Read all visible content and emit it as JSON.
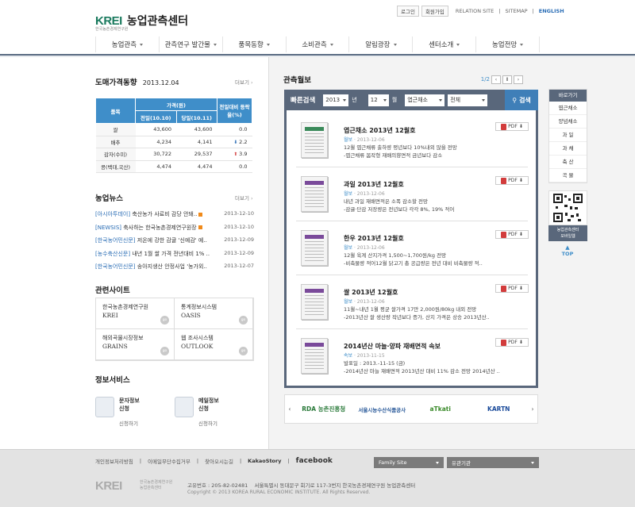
{
  "header": {
    "logo_mark": "KREI",
    "logo_sub": "한국농촌경제연구원",
    "title": "농업관측센터",
    "util": {
      "login": "로그인",
      "join": "회원가입",
      "relation": "RELATION SITE",
      "sitemap": "SITEMAP",
      "english": "ENGLISH"
    }
  },
  "nav": [
    "농업관측",
    "관측연구 발간물",
    "품목동향",
    "소비관측",
    "알림광장",
    "센터소개",
    "농업전망"
  ],
  "price": {
    "title": "도매가격동향",
    "date": "2013.12.04",
    "more": "더보기",
    "h_item": "품목",
    "h_price": "가격(원)",
    "h_change": "전일대비 등락율(%)",
    "h_prev": "전일(10.10)",
    "h_today": "당일(10.11)",
    "rows": [
      {
        "item": "쌀",
        "prev": "43,600",
        "today": "43,600",
        "dir": "",
        "rate": "0.0"
      },
      {
        "item": "배추",
        "prev": "4,234",
        "today": "4,141",
        "dir": "down",
        "rate": "2.2"
      },
      {
        "item": "감자(수미)",
        "prev": "30,722",
        "today": "29,537",
        "dir": "up",
        "rate": "3.9"
      },
      {
        "item": "콩(백태,국산)",
        "prev": "4,474",
        "today": "4,474",
        "dir": "",
        "rate": "0.0"
      }
    ]
  },
  "news": {
    "title": "농업뉴스",
    "more": "더보기",
    "items": [
      {
        "src": "[아시아투데이]",
        "text": "축산농가 사료비 감당 안돼..",
        "date": "2013-12-10",
        "new": true
      },
      {
        "src": "[NEWSIS]",
        "text": "축사하는 한국농촌경제연구원장",
        "date": "2013-12-10",
        "new": true
      },
      {
        "src": "[한국농어민신문]",
        "text": "저온에 강한 감귤 '신예감' 예..",
        "date": "2013-12-09",
        "new": false
      },
      {
        "src": "[농수축산신문]",
        "text": "내년 1월 쌀 가격 전년대비 1% ..",
        "date": "2013-12-09",
        "new": false
      },
      {
        "src": "[한국농어민신문]",
        "text": "송아지생산 안정사업 '농가외..",
        "date": "2013-12-07",
        "new": false
      }
    ]
  },
  "related": {
    "title": "관련사이트",
    "go": "go",
    "sites": [
      {
        "ko": "한국농촌경제연구원",
        "en": "KREI"
      },
      {
        "ko": "통계정보시스템",
        "en": "OASIS"
      },
      {
        "ko": "해외곡물시장정보",
        "en": "GRAINS"
      },
      {
        "ko": "웹 조사시스템",
        "en": "OUTLOOK"
      }
    ]
  },
  "service": {
    "title": "정보서비스",
    "items": [
      {
        "name": "문자정보\n신청",
        "link": "신청하기"
      },
      {
        "name": "메일정보\n신청",
        "link": "신청하기"
      }
    ]
  },
  "report": {
    "title": "관측월보",
    "page": "1/2",
    "search_label": "빠른검색",
    "year": "2013",
    "year_unit": "년",
    "month": "12",
    "month_unit": "월",
    "category": "엽근채소",
    "kind": "전체",
    "search_btn": "검색",
    "pdf": "PDF",
    "items": [
      {
        "title": "엽근채소 2013년 12월호",
        "cat": "월보",
        "date": "2013-12-06",
        "l1": "12월 엽근채류 출하량 평년보다 10%내외 많을 전망",
        "l2": "-엽근채류 봄작형 재배의향면적 금년보다 감소",
        "thumb": "green"
      },
      {
        "title": "과일 2013년 12월호",
        "cat": "월보",
        "date": "2013-12-06",
        "l1": "내년 과일 재배면적은 소폭 감소할 전망",
        "l2": "-감귤·단감 저장량은 전년보다 각각 8%, 19% 적어",
        "thumb": "purple"
      },
      {
        "title": "한우 2013년 12월호",
        "cat": "월보",
        "date": "2013-12-06",
        "l1": "12월 육계 산지가격 1,500~1,700원/kg 전망",
        "l2": "-비축물량 적어12월 닭고기 총 공급량은 전년 대비 비축물량 적..",
        "thumb": "purple"
      },
      {
        "title": "쌀 2013년 12월호",
        "cat": "월보",
        "date": "2013-12-06",
        "l1": "11월~내년 1월 평균 쌀가격 17만 2,000원/80kg 내외 전망",
        "l2": "-2013년산 쌀 생산량 작년보다 증가, 산지 가격은 상승 2013년산..",
        "thumb": "purple"
      },
      {
        "title": "2014년산 마늘·양파 재배면적 속보",
        "cat": "속보",
        "date": "2013-11-15",
        "l1": "발표일 : 2013.-11-15 (금)",
        "l2": "-2014년산 마늘 재배면적 2013년산 대비 11% 감소 전망 2014년산 ..",
        "thumb": "purple"
      }
    ]
  },
  "banner": {
    "logos": [
      "RDA 농촌진흥청",
      "서울시농수산식품공사",
      "aTkati",
      "KARTN"
    ]
  },
  "quick": {
    "title": "바로가기",
    "items": [
      "엽근채소",
      "양념채소",
      "과 일",
      "과 채",
      "축 산",
      "곡 물"
    ],
    "qr_caption": "농업관측센터\n모바일웹",
    "top": "TOP"
  },
  "footer": {
    "links": [
      "개인정보처리방침",
      "이메일무단수집거부",
      "찾아오시는길"
    ],
    "kakao": "KakaoStory",
    "facebook": "facebook",
    "family": "Family Site",
    "related": "유관기관",
    "logo": "KREI",
    "logo_sub": "한국농촌경제연구원\n농업관측센터",
    "addr": "고유번호 : 205-82-02481    서울특별시 동대문구 회기로 117-3번지 한국농촌경제연구원 농업관측센터",
    "copy": "Copyright © 2013 KOREA RURAL ECONOMIC INSTITUTE. All Rights Reserved."
  },
  "colors": {
    "accent": "#3f8ec9",
    "navy": "#59677b",
    "brand_green": "#1a7a5e"
  }
}
